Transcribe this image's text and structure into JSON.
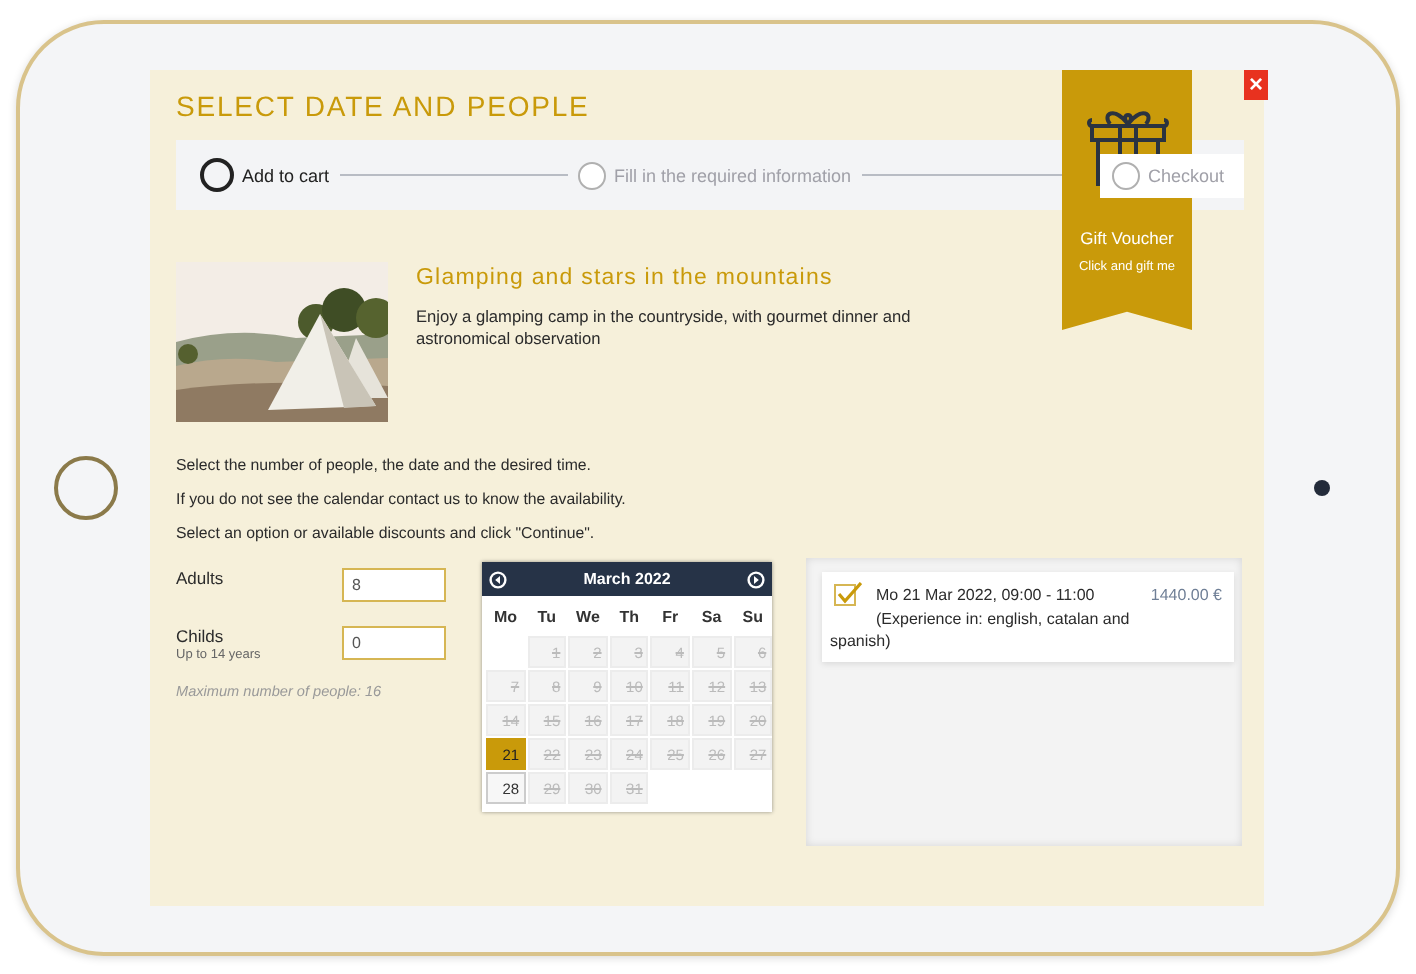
{
  "dialog": {
    "title": "SELECT DATE AND PEOPLE",
    "close": "×"
  },
  "steps": [
    {
      "label": "Add to cart",
      "active": true
    },
    {
      "label": "Fill in the required information",
      "active": false
    },
    {
      "label": "Checkout",
      "active": false
    }
  ],
  "gift_voucher": {
    "title": "Gift Voucher",
    "subtitle": "Click and gift me"
  },
  "product": {
    "title": "Glamping and stars in the mountains",
    "description": "Enjoy a glamping camp in the countryside, with gourmet dinner and astronomical observation"
  },
  "instructions": [
    "Select the number of people, the date and the desired time.",
    "If you do not see the calendar contact us to know the availability.",
    "Select an option or available discounts and click \"Continue\"."
  ],
  "people_form": {
    "fields": [
      {
        "label": "Adults",
        "value": "8"
      },
      {
        "label": "Childs",
        "hint": "Up to 14 years",
        "value": "0"
      }
    ],
    "note": "Maximum number of people: 16"
  },
  "calendar": {
    "month": "March 2022",
    "weekdays": [
      "Mo",
      "Tu",
      "We",
      "Th",
      "Fr",
      "Sa",
      "Su"
    ],
    "weeks": [
      [
        {
          "kind": "blank"
        },
        {
          "kind": "day",
          "day": "1",
          "disabled": true,
          "selected": false
        },
        {
          "kind": "day",
          "day": "2",
          "disabled": true,
          "selected": false
        },
        {
          "kind": "day",
          "day": "3",
          "disabled": true,
          "selected": false
        },
        {
          "kind": "day",
          "day": "4",
          "disabled": true,
          "selected": false
        },
        {
          "kind": "day",
          "day": "5",
          "disabled": true,
          "selected": false
        },
        {
          "kind": "day",
          "day": "6",
          "disabled": true,
          "selected": false
        }
      ],
      [
        {
          "kind": "day",
          "day": "7",
          "disabled": true,
          "selected": false
        },
        {
          "kind": "day",
          "day": "8",
          "disabled": true,
          "selected": false
        },
        {
          "kind": "day",
          "day": "9",
          "disabled": true,
          "selected": false
        },
        {
          "kind": "day",
          "day": "10",
          "disabled": true,
          "selected": false
        },
        {
          "kind": "day",
          "day": "11",
          "disabled": true,
          "selected": false
        },
        {
          "kind": "day",
          "day": "12",
          "disabled": true,
          "selected": false
        },
        {
          "kind": "day",
          "day": "13",
          "disabled": true,
          "selected": false
        }
      ],
      [
        {
          "kind": "day",
          "day": "14",
          "disabled": true,
          "selected": false
        },
        {
          "kind": "day",
          "day": "15",
          "disabled": true,
          "selected": false
        },
        {
          "kind": "day",
          "day": "16",
          "disabled": true,
          "selected": false
        },
        {
          "kind": "day",
          "day": "17",
          "disabled": true,
          "selected": false
        },
        {
          "kind": "day",
          "day": "18",
          "disabled": true,
          "selected": false
        },
        {
          "kind": "day",
          "day": "19",
          "disabled": true,
          "selected": false
        },
        {
          "kind": "day",
          "day": "20",
          "disabled": true,
          "selected": false
        }
      ],
      [
        {
          "kind": "day",
          "day": "21",
          "disabled": false,
          "selected": true
        },
        {
          "kind": "day",
          "day": "22",
          "disabled": true,
          "selected": false
        },
        {
          "kind": "day",
          "day": "23",
          "disabled": true,
          "selected": false
        },
        {
          "kind": "day",
          "day": "24",
          "disabled": true,
          "selected": false
        },
        {
          "kind": "day",
          "day": "25",
          "disabled": true,
          "selected": false
        },
        {
          "kind": "day",
          "day": "26",
          "disabled": true,
          "selected": false
        },
        {
          "kind": "day",
          "day": "27",
          "disabled": true,
          "selected": false
        }
      ],
      [
        {
          "kind": "day",
          "day": "28",
          "disabled": false,
          "selected": false
        },
        {
          "kind": "day",
          "day": "29",
          "disabled": true,
          "selected": false
        },
        {
          "kind": "day",
          "day": "30",
          "disabled": true,
          "selected": false
        },
        {
          "kind": "day",
          "day": "31",
          "disabled": true,
          "selected": false
        },
        {
          "kind": "blank"
        },
        {
          "kind": "blank"
        },
        {
          "kind": "blank"
        }
      ]
    ]
  },
  "slots": [
    {
      "title": "Mo 21 Mar 2022, 09:00 - 11:00",
      "details": "(Experience in: english, catalan and spanish)",
      "price": "1440.00 €",
      "checked": true
    }
  ]
}
